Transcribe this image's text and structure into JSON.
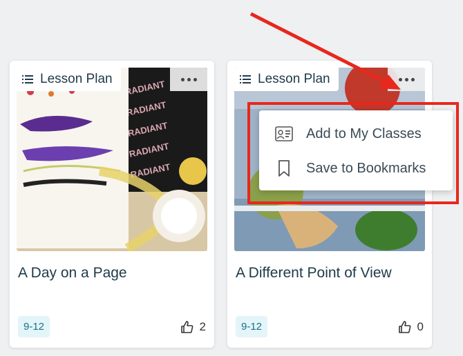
{
  "cards": [
    {
      "type_label": "Lesson Plan",
      "title": "A Day on a Page",
      "grade": "9-12",
      "likes": "2"
    },
    {
      "type_label": "Lesson Plan",
      "title": "A Different Point of View",
      "grade": "9-12",
      "likes": "0"
    }
  ],
  "menu": {
    "add_label": "Add to My Classes",
    "save_label": "Save to Bookmarks"
  },
  "colors": {
    "annotation": "#e8271d",
    "text": "#1e3a4a",
    "grade_bg": "#e3f5f9"
  }
}
